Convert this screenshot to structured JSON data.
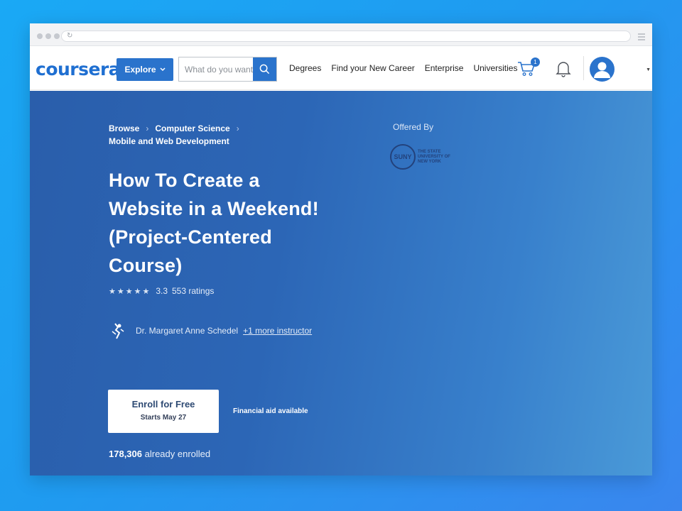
{
  "browser": {
    "reload_icon": "reload-icon"
  },
  "nav": {
    "logo": "coursera",
    "explore_label": "Explore",
    "search_placeholder": "What do you want to learn?",
    "links": [
      "Degrees",
      "Find your New Career",
      "Enterprise",
      "Universities"
    ],
    "cart_count": "1"
  },
  "course": {
    "breadcrumb": [
      "Browse",
      "Computer Science",
      "Mobile and Web Development"
    ],
    "offered_by_label": "Offered By",
    "university_short": "SUNY",
    "university_full": "THE STATE UNIVERSITY OF NEW YORK",
    "title": "How To Create a Website in a Weekend! (Project-Centered Course)",
    "rating": "3.3",
    "rating_value": 3.3,
    "ratings_count": "553 ratings",
    "instructor": "Dr. Margaret Anne Schedel",
    "more_instructors": "+1 more instructor",
    "enroll_label": "Enroll for Free",
    "enroll_sub": "Starts May 27",
    "financial_aid": "Financial aid available",
    "enrolled_count": "178,306",
    "enrolled_text": "already enrolled"
  },
  "colors": {
    "brand": "#2a73cc",
    "hero": "#2c66b6"
  }
}
